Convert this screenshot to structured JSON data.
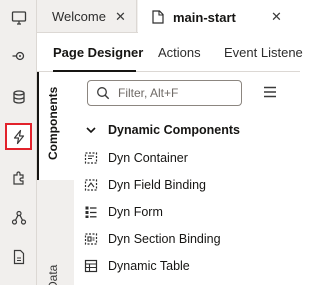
{
  "rail": {
    "items": [
      {
        "icon": "monitor-icon"
      },
      {
        "icon": "service-connection-icon"
      },
      {
        "icon": "database-icon"
      },
      {
        "icon": "lightning-icon",
        "active": true
      },
      {
        "icon": "puzzle-icon"
      },
      {
        "icon": "hierarchy-icon"
      },
      {
        "icon": "document-icon"
      }
    ]
  },
  "tabs": [
    {
      "label": "Welcome",
      "close": "✕"
    },
    {
      "label": "main-start",
      "close": "✕"
    }
  ],
  "subtabs": [
    "Page Designer",
    "Actions",
    "Event Listene"
  ],
  "sidetabs": {
    "components": "Components",
    "data": "Data"
  },
  "search": {
    "placeholder": "Filter, Alt+F"
  },
  "palette": {
    "group_label": "Dynamic Components",
    "items": [
      "Dyn Container",
      "Dyn Field Binding",
      "Dyn Form",
      "Dyn Section Binding",
      "Dynamic Table"
    ]
  },
  "colors": {
    "active_outline": "#e2222b",
    "rail_bg": "#f1efed"
  }
}
